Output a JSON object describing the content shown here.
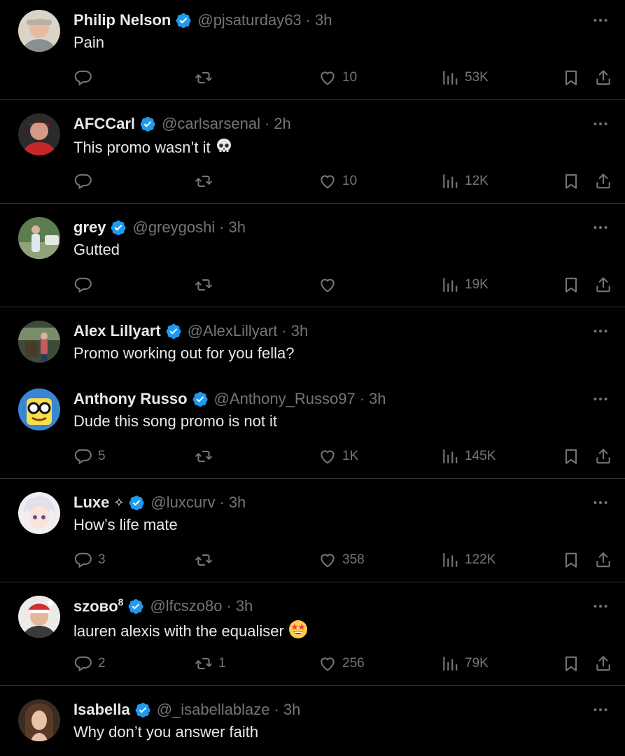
{
  "tweets": [
    {
      "name": "Philip Nelson",
      "handle": "@pjsaturday63",
      "time": "3h",
      "text": "Pain",
      "replies": "",
      "reposts": "",
      "likes": "10",
      "views": "53K",
      "emoji": ""
    },
    {
      "name": "AFCCarl",
      "handle": "@carlsarsenal",
      "time": "2h",
      "text": "This promo wasn’t it",
      "replies": "",
      "reposts": "",
      "likes": "10",
      "views": "12K",
      "emoji": "skull"
    },
    {
      "name": "grey",
      "handle": "@greygoshi",
      "time": "3h",
      "text": "Gutted",
      "replies": "",
      "reposts": "",
      "likes": "",
      "views": "19K",
      "emoji": ""
    },
    {
      "name": "Alex Lillyart",
      "handle": "@AlexLillyart",
      "time": "3h",
      "text": "Promo working out for you fella?"
    },
    {
      "name": "Anthony Russo",
      "handle": "@Anthony_Russo97",
      "time": "3h",
      "text": "Dude this song promo is not it",
      "replies": "5",
      "reposts": "",
      "likes": "1K",
      "views": "145K",
      "emoji": ""
    },
    {
      "name": "Luxe",
      "name_extra": "✧",
      "handle": "@luxcurv",
      "time": "3h",
      "text": "How’s life mate",
      "replies": "3",
      "reposts": "",
      "likes": "358",
      "views": "122K",
      "emoji": ""
    },
    {
      "name": "szoʙᴏ",
      "name_sup": "8",
      "handle": "@lfcszo8o",
      "time": "3h",
      "text": "lauren alexis with the equaliser",
      "replies": "2",
      "reposts": "1",
      "likes": "256",
      "views": "79K",
      "emoji": "star-struck"
    },
    {
      "name": "Isabella",
      "handle": "@_isabellablaze",
      "time": "3h",
      "text": "Why don’t you answer faith"
    }
  ],
  "colors": {
    "background": "#000000",
    "text": "#e7e9ea",
    "muted": "#71767b",
    "verified": "#1d9bf0",
    "divider": "#2f3336"
  },
  "icons": [
    "verified-badge-icon",
    "more-icon",
    "reply-icon",
    "repost-icon",
    "like-icon",
    "views-icon",
    "bookmark-icon",
    "share-icon"
  ]
}
